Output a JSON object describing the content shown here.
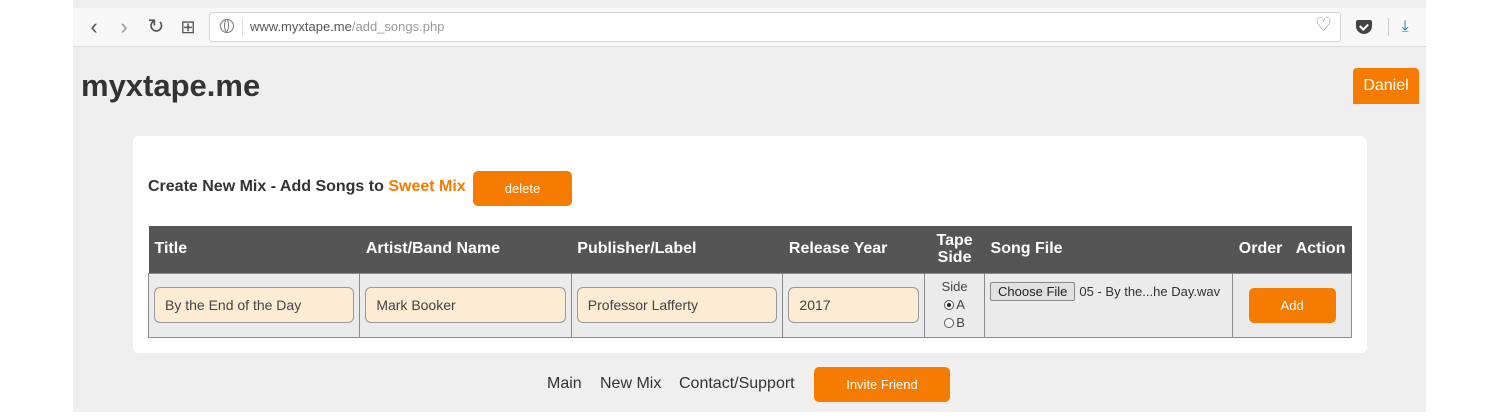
{
  "browser": {
    "url_host": "www.myxtape.me",
    "url_path": "/add_songs.php",
    "back_icon": "‹",
    "forward_icon": "›",
    "reload_icon": "↻",
    "apps_icon": "⊞",
    "heart_icon": "♡",
    "download_icon": "⤓"
  },
  "header": {
    "logo": "myxtape.me",
    "user_button": "Daniel"
  },
  "panel": {
    "heading_prefix": "Create New Mix - Add Songs to ",
    "mix_name": "Sweet Mix",
    "delete_label": "delete"
  },
  "table": {
    "columns": {
      "title": "Title",
      "artist": "Artist/Band Name",
      "publisher": "Publisher/Label",
      "year": "Release Year",
      "tape_side_1": "Tape",
      "tape_side_2": "Side",
      "song_file": "Song File",
      "order": "Order",
      "action": "Action"
    },
    "row": {
      "title": "By the End of the Day",
      "artist": "Mark Booker",
      "publisher": "Professor Lafferty",
      "year": "2017",
      "side_label": "Side",
      "side_a": "A",
      "side_b": "B",
      "selected_side": "A",
      "choose_file_label": "Choose File",
      "file_name": "05 - By the...he Day.wav",
      "add_label": "Add"
    }
  },
  "footer": {
    "main": "Main",
    "new_mix": "New Mix",
    "contact": "Contact/Support",
    "invite": "Invite Friend"
  },
  "colors": {
    "accent": "#f57c00",
    "header_bg": "#555555",
    "field_bg": "#fdebd3"
  }
}
